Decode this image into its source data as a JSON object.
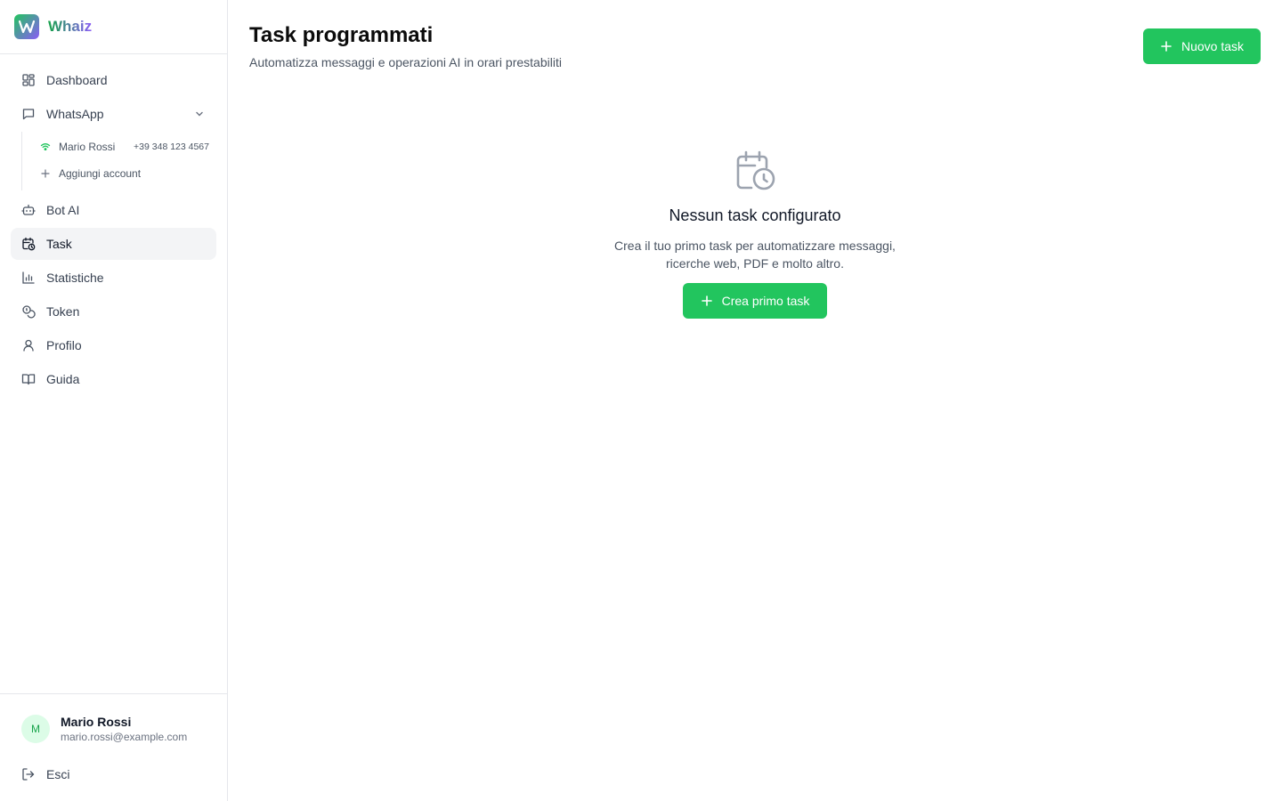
{
  "brand": {
    "name": "Whaiz",
    "logo_letter": "W"
  },
  "sidebar": {
    "items": [
      {
        "label": "Dashboard",
        "icon": "dashboard-icon"
      },
      {
        "label": "WhatsApp",
        "icon": "message-square-icon"
      },
      {
        "label": "Bot AI",
        "icon": "bot-icon"
      },
      {
        "label": "Task",
        "icon": "calendar-clock-icon"
      },
      {
        "label": "Statistiche",
        "icon": "bar-chart-icon"
      },
      {
        "label": "Token",
        "icon": "coins-icon"
      },
      {
        "label": "Profilo",
        "icon": "user-icon"
      },
      {
        "label": "Guida",
        "icon": "book-open-icon"
      }
    ],
    "whatsapp_accounts": [
      {
        "name": "Mario Rossi",
        "phone": "+39 348 123 4567",
        "status_icon": "wifi-icon"
      }
    ],
    "add_account_label": "Aggiungi account",
    "active": "Task"
  },
  "user": {
    "initial": "M",
    "name": "Mario Rossi",
    "email": "mario.rossi@example.com"
  },
  "logout_label": "Esci",
  "page": {
    "title": "Task programmati",
    "subtitle": "Automatizza messaggi e operazioni AI in orari prestabiliti",
    "new_task_label": "Nuovo task"
  },
  "empty_state": {
    "title": "Nessun task configurato",
    "description": "Crea il tuo primo task per automatizzare messaggi, ricerche web, PDF e molto altro.",
    "button_label": "Crea primo task",
    "icon": "calendar-clock-icon"
  },
  "colors": {
    "accent": "#22c55e",
    "active_bg": "#f3f4f6",
    "avatar_bg": "#dcfce7"
  }
}
